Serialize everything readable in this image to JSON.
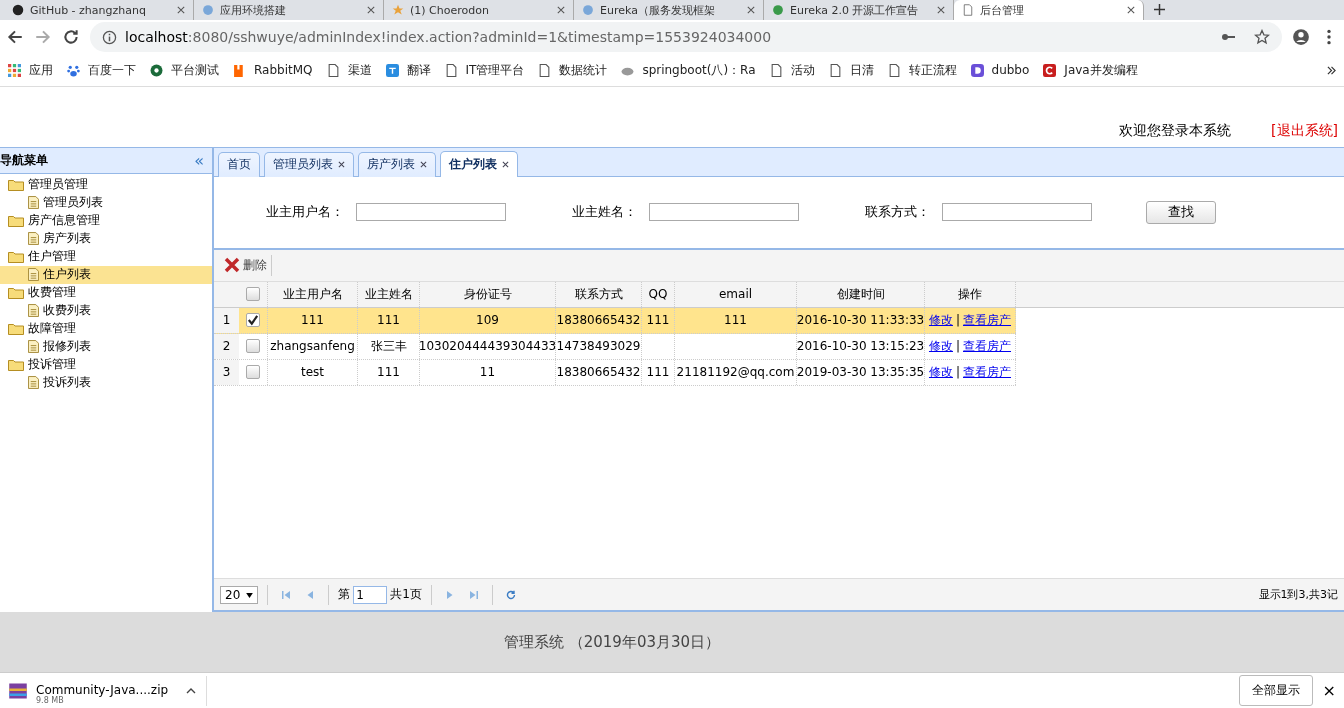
{
  "browser": {
    "tabs": [
      {
        "title": "GitHub - zhangzhanq",
        "selected": false
      },
      {
        "title": "应用环境搭建",
        "selected": false
      },
      {
        "title": "(1) Choerodon",
        "selected": false
      },
      {
        "title": "Eureka（服务发现框架",
        "selected": false
      },
      {
        "title": "Eureka 2.0 开源工作宣告",
        "selected": false
      },
      {
        "title": "后台管理",
        "selected": true
      }
    ],
    "url_host": "localhost",
    "url_rest": ":8080/sshwuye/adminIndex!index.action?adminId=1&timestamp=1553924034000",
    "bookmarks": [
      {
        "label": "应用"
      },
      {
        "label": "百度一下"
      },
      {
        "label": "平台测试"
      },
      {
        "label": "RabbitMQ"
      },
      {
        "label": "渠道"
      },
      {
        "label": "翻译"
      },
      {
        "label": "IT管理平台"
      },
      {
        "label": "数据统计"
      },
      {
        "label": "springboot(八)：Ra"
      },
      {
        "label": "活动"
      },
      {
        "label": "日清"
      },
      {
        "label": "转正流程"
      },
      {
        "label": "dubbo"
      },
      {
        "label": "Java并发编程"
      }
    ]
  },
  "header": {
    "welcome": "欢迎您登录本系统",
    "logout": "[退出系统]"
  },
  "sidebar": {
    "title": "导航菜单",
    "collapse": "«",
    "items": [
      {
        "label": "管理员管理",
        "children": [
          {
            "label": "管理员列表",
            "selected": false
          }
        ]
      },
      {
        "label": "房产信息管理",
        "children": [
          {
            "label": "房产列表",
            "selected": false
          }
        ]
      },
      {
        "label": "住户管理",
        "children": [
          {
            "label": "住户列表",
            "selected": true
          }
        ]
      },
      {
        "label": "收费管理",
        "children": [
          {
            "label": "收费列表",
            "selected": false
          }
        ]
      },
      {
        "label": "故障管理",
        "children": [
          {
            "label": "报修列表",
            "selected": false
          }
        ]
      },
      {
        "label": "投诉管理",
        "children": [
          {
            "label": "投诉列表",
            "selected": false
          }
        ]
      }
    ]
  },
  "tabs": [
    {
      "label": "首页",
      "closable": false,
      "selected": false
    },
    {
      "label": "管理员列表",
      "closable": true,
      "selected": false
    },
    {
      "label": "房产列表",
      "closable": true,
      "selected": false
    },
    {
      "label": "住户列表",
      "closable": true,
      "selected": true
    }
  ],
  "search": {
    "fields": [
      {
        "label": "业主用户名："
      },
      {
        "label": "业主姓名："
      },
      {
        "label": "联系方式："
      }
    ],
    "button": "查找"
  },
  "toolbar": {
    "delete": "删除"
  },
  "table": {
    "all_checked": false,
    "columns": [
      "业主用户名",
      "业主姓名",
      "身份证号",
      "联系方式",
      "QQ",
      "email",
      "创建时间",
      "操作"
    ],
    "rows": [
      {
        "index": "1",
        "selected": true,
        "checked": true,
        "cells": [
          "111",
          "111",
          "109",
          "18380665432",
          "111",
          "111",
          "2016-10-30 11:33:33"
        ],
        "actions": [
          "修改",
          "|",
          "查看房产"
        ]
      },
      {
        "index": "2",
        "selected": false,
        "checked": false,
        "cells": [
          "zhangsanfeng",
          "张三丰",
          "103020444439304433",
          "14738493029",
          "",
          "",
          "2016-10-30 13:15:23"
        ],
        "actions": [
          "修改",
          "|",
          "查看房产"
        ]
      },
      {
        "index": "3",
        "selected": false,
        "checked": false,
        "cells": [
          "test",
          "111",
          "11",
          "18380665432",
          "111",
          "21181192@qq.com",
          "2019-03-30 13:35:35"
        ],
        "actions": [
          "修改",
          "|",
          "查看房产"
        ]
      }
    ]
  },
  "pager": {
    "page_size": "20",
    "page_prefix": "第",
    "page": "1",
    "page_suffix": "共1页",
    "summary": "显示1到3,共3记"
  },
  "footer": "管理系统 （2019年03月30日）",
  "downloads": {
    "file": "Community-Java....zip",
    "size": "9.8 MB",
    "show_all": "全部显示",
    "close": "×"
  }
}
